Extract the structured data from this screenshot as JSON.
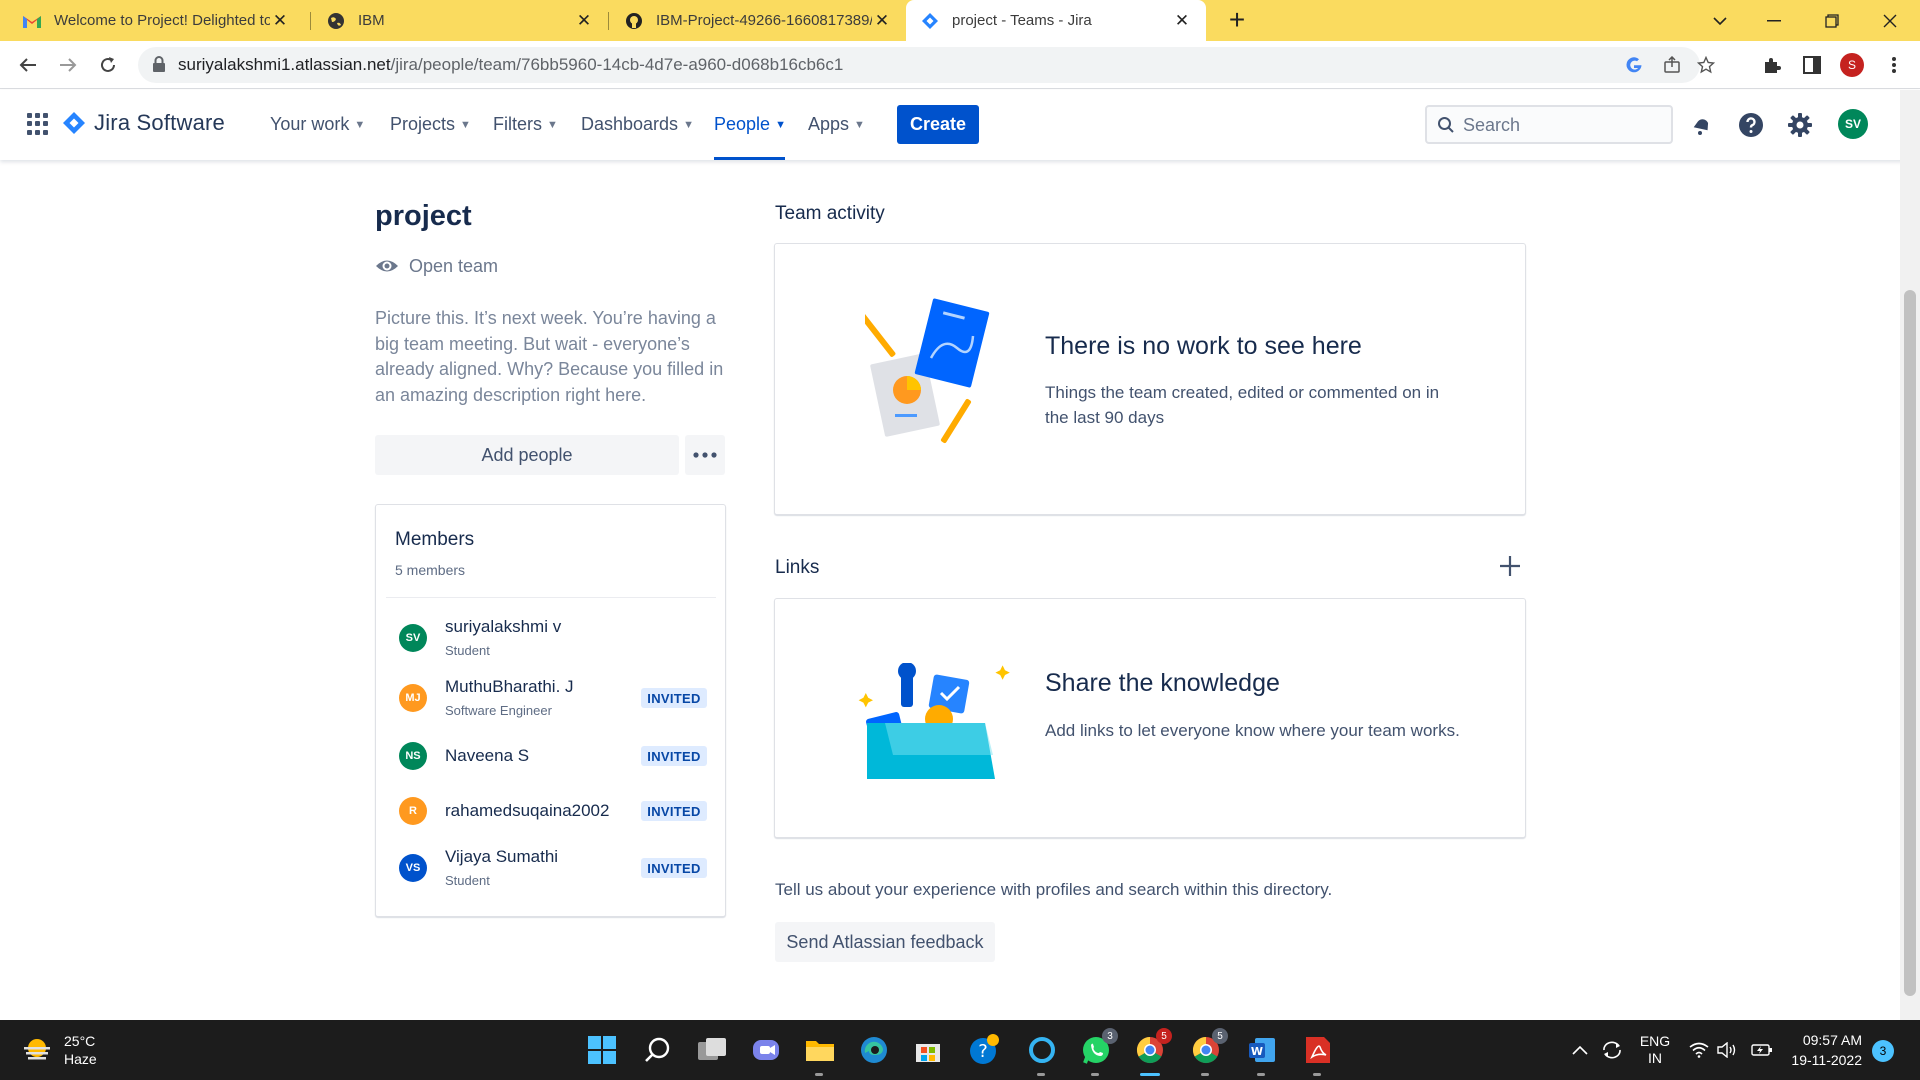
{
  "browser": {
    "tabs": [
      {
        "title": "Welcome to Project! Delighted to",
        "icon": "gmail-icon",
        "active": false
      },
      {
        "title": "IBM",
        "icon": "globe-icon",
        "active": false
      },
      {
        "title": "IBM-Project-49266-1660817389/",
        "icon": "github-icon",
        "active": false
      },
      {
        "title": "project - Teams - Jira",
        "icon": "jira-icon",
        "active": true
      }
    ],
    "tab_close_glyph": "✕",
    "new_tab_glyph": "+",
    "url_host": "suriyalakshmi1.atlassian.net",
    "url_path": "/jira/people/team/76bb5960-14cb-4d7e-a960-d068b16cb6c1",
    "profile_initial": "S"
  },
  "jira": {
    "app_name": "Jira Software",
    "nav": [
      {
        "label": "Your work",
        "selected": false
      },
      {
        "label": "Projects",
        "selected": false
      },
      {
        "label": "Filters",
        "selected": false
      },
      {
        "label": "Dashboards",
        "selected": false
      },
      {
        "label": "People",
        "selected": true
      },
      {
        "label": "Apps",
        "selected": false
      }
    ],
    "create_label": "Create",
    "search_placeholder": "Search",
    "user_initials": "SV",
    "accent_color": "#0052cc"
  },
  "team": {
    "name": "project",
    "type_label": "Open team",
    "description": "Picture this. It’s next week. You’re having a big team meeting. But wait - everyone’s already aligned. Why? Because you filled in an amazing description right here.",
    "add_people_label": "Add people",
    "more_glyph": "•••"
  },
  "members": {
    "title": "Members",
    "count_label": "5 members",
    "list": [
      {
        "initials": "SV",
        "name": "suriyalakshmi v",
        "role": "Student",
        "status": "",
        "color": "#00875a"
      },
      {
        "initials": "MJ",
        "name": "MuthuBharathi. J",
        "role": "Software Engineer",
        "status": "INVITED",
        "color": "#ff991f"
      },
      {
        "initials": "NS",
        "name": "Naveena S",
        "role": "",
        "status": "INVITED",
        "color": "#00875a"
      },
      {
        "initials": "R",
        "name": "rahamedsuqaina2002",
        "role": "",
        "status": "INVITED",
        "color": "#ff991f"
      },
      {
        "initials": "VS",
        "name": "Vijaya Sumathi",
        "role": "Student",
        "status": "INVITED",
        "color": "#0052cc"
      }
    ]
  },
  "activity": {
    "heading": "Team activity",
    "empty_title": "There is no work to see here",
    "empty_text": "Things the team created, edited or commented on in the last 90 days"
  },
  "links": {
    "heading": "Links",
    "empty_title": "Share the knowledge",
    "empty_text": "Add links to let everyone know where your team works."
  },
  "feedback": {
    "text": "Tell us about your experience with profiles and search within this directory.",
    "button_label": "Send Atlassian feedback"
  },
  "taskbar": {
    "temperature": "25°C",
    "condition": "Haze",
    "language_line1": "ENG",
    "language_line2": "IN",
    "time": "09:57 AM",
    "date": "19-11-2022",
    "notification_count": "3",
    "badges": {
      "whatsapp": "3",
      "chrome": "5",
      "chrome2": "5"
    }
  }
}
